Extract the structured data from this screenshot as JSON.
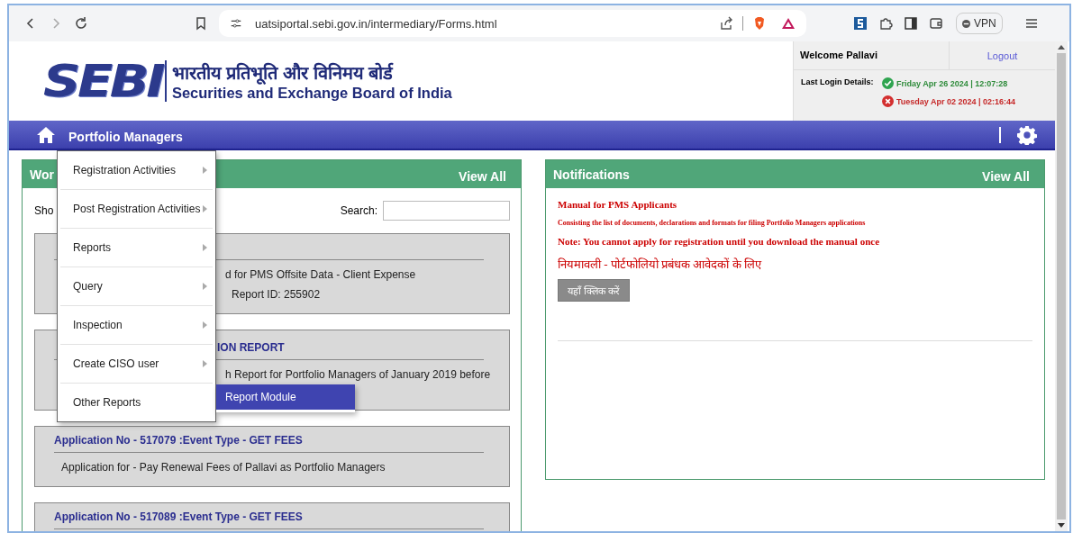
{
  "browser": {
    "url": "uatsiportal.sebi.gov.in/intermediary/Forms.html",
    "vpn_label": "VPN"
  },
  "header": {
    "logo_text": "SEBI",
    "title_hindi": "भारतीय प्रतिभूति और विनिमय बोर्ड",
    "title": "Securities and Exchange Board of India"
  },
  "user_box": {
    "welcome": "Welcome Pallavi",
    "logout": "Logout",
    "last_login_label": "Last Login Details:",
    "logins": [
      {
        "text": "Friday Apr 26 2024 | 12:07:28",
        "success": true
      },
      {
        "text": "Tuesday Apr 02 2024 | 02:16:44",
        "success": false
      }
    ]
  },
  "nav": {
    "title": "Portfolio Managers"
  },
  "menu": {
    "items": [
      {
        "label": "Registration Activities",
        "has_submenu": true
      },
      {
        "label": "Post Registration Activities",
        "has_submenu": true
      },
      {
        "label": "Reports",
        "has_submenu": true
      },
      {
        "label": "Query",
        "has_submenu": true
      },
      {
        "label": "Inspection",
        "has_submenu": true
      },
      {
        "label": "Create CISO user",
        "has_submenu": true
      },
      {
        "label": "Other Reports",
        "has_submenu": false
      }
    ],
    "submenu": [
      {
        "label": "Report Module",
        "selected": true
      }
    ]
  },
  "workflow": {
    "title": "Wor",
    "view_all": "View All",
    "show_label": "Sho",
    "search_label": "Search:",
    "cards": [
      {
        "kind": "covered",
        "lines": [
          "d for PMS Offsite Data - Client Expense",
          "Report ID: 255902"
        ]
      },
      {
        "kind": "covered",
        "title": "ION REPORT",
        "lines": [
          "h Report for Portfolio Managers of January 2019 before"
        ]
      },
      {
        "kind": "full",
        "title": "Application No - 517079 :Event Type - GET FEES",
        "lines": [
          "Application for - Pay Renewal Fees of Pallavi as Portfolio Managers"
        ]
      },
      {
        "kind": "full",
        "title": "Application No - 517089 :Event Type - GET FEES"
      }
    ]
  },
  "notifications": {
    "title": "Notifications",
    "view_all": "View All",
    "lines": [
      {
        "kind": "heading",
        "text": "Manual for PMS Applicants"
      },
      {
        "kind": "small",
        "text": "Consisting the list of documents, declarations and formats for filing Portfolio Managers applications"
      },
      {
        "kind": "heading",
        "text": "Note: You cannot apply for registration until you download the manual once"
      },
      {
        "kind": "hindi",
        "text": "नियमावली - पोर्टफोलियो प्रबंधक आवेदकों के लिए"
      }
    ],
    "button": "यहाँ क्लिक करें"
  }
}
